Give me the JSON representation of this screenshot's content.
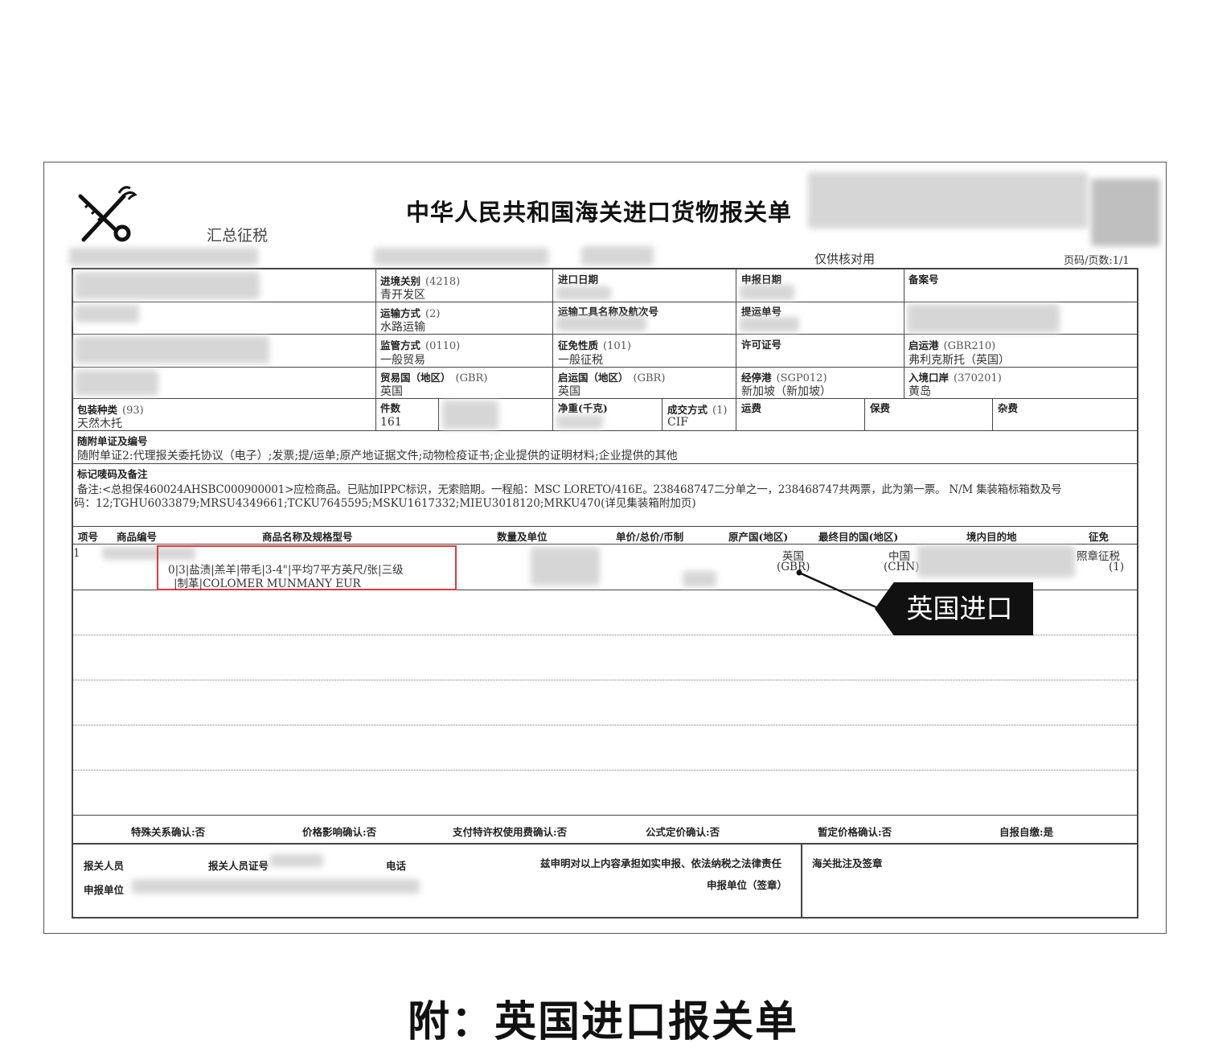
{
  "header": {
    "title": "中华人民共和国海关进口货物报关单",
    "tax_mode": "汇总征税",
    "verify_only": "仅供核对用",
    "page_label": "页码/页数:1/1"
  },
  "row1": {
    "entry_customs": {
      "label": "进境关别",
      "code": "(4218)",
      "value": "青开发区"
    },
    "import_date": {
      "label": "进口日期"
    },
    "declare_date": {
      "label": "申报日期"
    },
    "record_no": {
      "label": "备案号"
    }
  },
  "row2": {
    "transport_mode": {
      "label": "运输方式",
      "code": "(2)",
      "value": "水路运输"
    },
    "vessel": {
      "label": "运输工具名称及航次号"
    },
    "bill_no": {
      "label": "提运单号"
    }
  },
  "row3": {
    "supervision": {
      "label": "监管方式",
      "code": "(0110)",
      "value": "一般贸易"
    },
    "levy_nature": {
      "label": "征免性质",
      "code": "(101)",
      "value": "一般征税"
    },
    "license": {
      "label": "许可证号"
    },
    "departure_port": {
      "label": "启运港",
      "code": "(GBR210)",
      "value": "弗利克斯托（英国）"
    }
  },
  "row4": {
    "trade_country": {
      "label": "贸易国（地区）",
      "code": "(GBR)",
      "value": "英国"
    },
    "origin_country": {
      "label": "启运国（地区）",
      "code": "(GBR)",
      "value": "英国"
    },
    "transit_port": {
      "label": "经停港",
      "code": "(SGP012)",
      "value": "新加坡（新加坡）"
    },
    "entry_port": {
      "label": "入境口岸",
      "code": "(370201)",
      "value": "黄岛"
    }
  },
  "row5": {
    "package_type": {
      "label": "包装种类",
      "code": "(93)",
      "value": "天然木托"
    },
    "pieces": {
      "label": "件数",
      "value": "161"
    },
    "net_weight": {
      "label": "净重(千克)"
    },
    "deal_mode": {
      "label": "成交方式",
      "code": "(1)",
      "value": "CIF"
    },
    "freight": {
      "label": "运费"
    },
    "insurance": {
      "label": "保费"
    },
    "misc": {
      "label": "杂费"
    }
  },
  "documents": {
    "label": "随附单证及编号",
    "value": "随附单证2:代理报关委托协议（电子）;发票;提/运单;原产地证据文件;动物检疫证书;企业提供的证明材料;企业提供的其他"
  },
  "remarks": {
    "label": "标记唛码及备注",
    "line1": "备注:<总担保460024AHSBC000900001>应检商品。已贴加IPPC标识，无索赔期。一程船：MSC LORETO/416E。238468747二分单之一，238468747共两票，此为第一票。 N/M  集装箱标箱数及号",
    "line2": "码：12;TGHU6033879;MRSU4349661;TCKU7645595;MSKU1617332;MIEU3018120;MRKU470(详见集装箱附加页)"
  },
  "goods_header": [
    "项号",
    "商品编号",
    "商品名称及规格型号",
    "数量及单位",
    "单价/总价/币制",
    "原产国(地区)",
    "最终目的国(地区)",
    "境内目的地",
    "征免"
  ],
  "goods_rows": [
    {
      "item_no": "1",
      "name_line1": "0|3|盐渍|羔羊|带毛|3-4\"|平均7平方英尺/张|三级",
      "name_line2": "|制革|COLOMER MUNMANY EUR",
      "origin": "英国",
      "origin_code": "(GBR)",
      "destination": "中国",
      "destination_code": "(CHN)",
      "levy": "照章征税",
      "levy_code": "(1)"
    }
  ],
  "confirmations": {
    "special_relation": "特殊关系确认:否",
    "price_influence": "价格影响确认:否",
    "royalty": "支付特许权使用费确认:否",
    "formula_price": "公式定价确认:否",
    "provisional_price": "暂定价格确认:否",
    "self_pay": "自报自缴:是"
  },
  "footer": {
    "broker": "报关人员",
    "broker_id": "报关人员证号",
    "phone": "电话",
    "declaration": "兹申明对以上内容承担如实申报、依法纳税之法律责任",
    "declaring_unit": "申报单位",
    "seal": "申报单位（签章）",
    "customs_approval": "海关批注及签章"
  },
  "callout": "英国进口",
  "caption": "附：英国进口报关单",
  "colors": {
    "highlight_box": "#e53935",
    "callout_bg": "#111111"
  },
  "icons": {
    "logo": "customs-emblem-icon"
  }
}
